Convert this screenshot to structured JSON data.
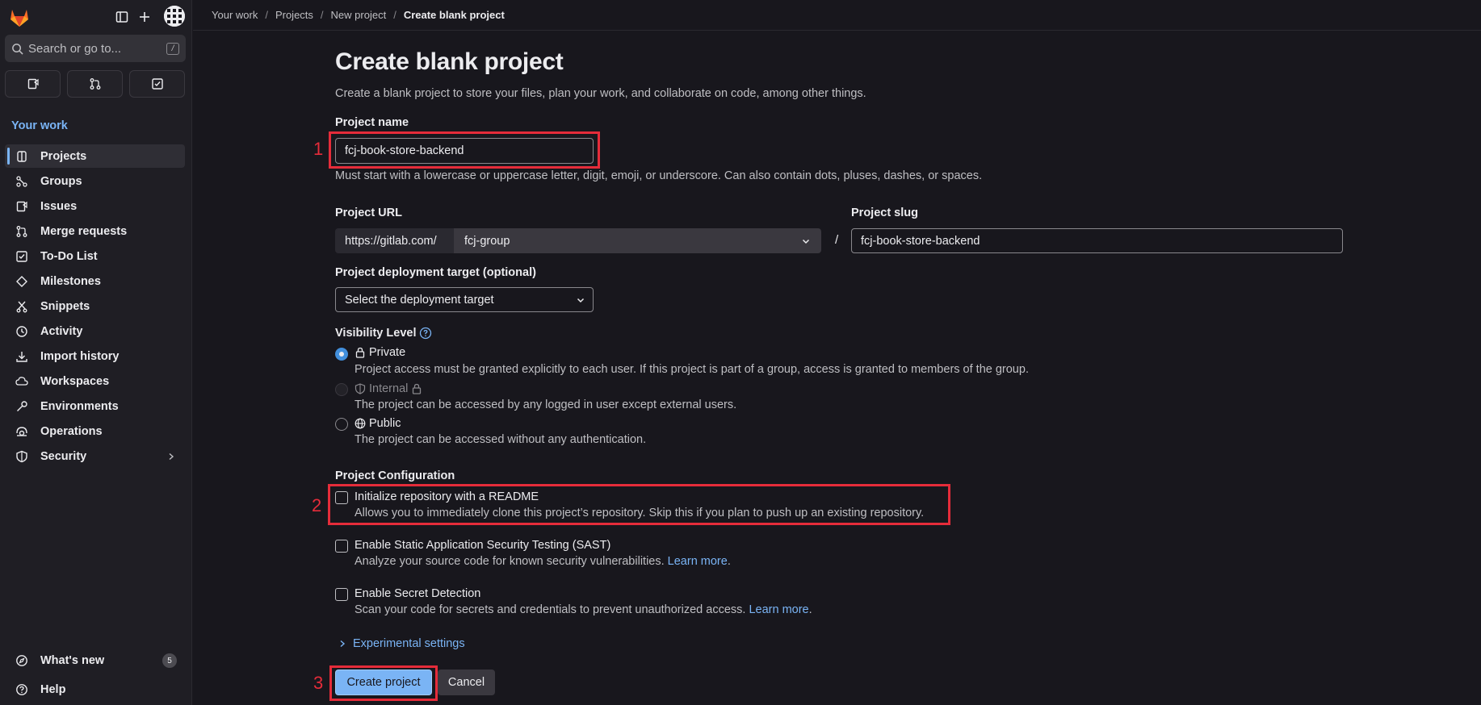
{
  "sidebar": {
    "search_placeholder": "Search or go to...",
    "search_shortcut": "/",
    "section_title": "Your work",
    "items": [
      {
        "label": "Projects",
        "icon": "project-icon",
        "active": true
      },
      {
        "label": "Groups",
        "icon": "group-icon"
      },
      {
        "label": "Issues",
        "icon": "issues-icon"
      },
      {
        "label": "Merge requests",
        "icon": "merge-request-icon"
      },
      {
        "label": "To-Do List",
        "icon": "todo-icon"
      },
      {
        "label": "Milestones",
        "icon": "milestone-icon"
      },
      {
        "label": "Snippets",
        "icon": "snippet-icon"
      },
      {
        "label": "Activity",
        "icon": "activity-icon"
      },
      {
        "label": "Import history",
        "icon": "import-icon"
      },
      {
        "label": "Workspaces",
        "icon": "workspace-icon"
      },
      {
        "label": "Environments",
        "icon": "environment-icon"
      },
      {
        "label": "Operations",
        "icon": "operations-icon"
      },
      {
        "label": "Security",
        "icon": "shield-icon"
      }
    ],
    "whats_new": "What's new",
    "whats_new_count": "5",
    "help": "Help"
  },
  "breadcrumb": [
    "Your work",
    "Projects",
    "New project",
    "Create blank project"
  ],
  "page": {
    "title": "Create blank project",
    "lead": "Create a blank project to store your files, plan your work, and collaborate on code, among other things.",
    "project_name_label": "Project name",
    "project_name_value": "fcj-book-store-backend",
    "project_name_help": "Must start with a lowercase or uppercase letter, digit, emoji, or underscore. Can also contain dots, pluses, dashes, or spaces.",
    "project_url_label": "Project URL",
    "url_prefix": "https://gitlab.com/",
    "namespace": "fcj-group",
    "slash": "/",
    "project_slug_label": "Project slug",
    "project_slug_value": "fcj-book-store-backend",
    "deploy_label": "Project deployment target (optional)",
    "deploy_value": "Select the deployment target",
    "visibility_label": "Visibility Level",
    "visibility": {
      "private": "Private",
      "private_desc": "Project access must be granted explicitly to each user. If this project is part of a group, access is granted to members of the group.",
      "internal": "Internal",
      "internal_desc": "The project can be accessed by any logged in user except external users.",
      "public": "Public",
      "public_desc": "The project can be accessed without any authentication."
    },
    "config_label": "Project Configuration",
    "readme": "Initialize repository with a README",
    "readme_desc": "Allows you to immediately clone this project’s repository. Skip this if you plan to push up an existing repository.",
    "sast": "Enable Static Application Security Testing (SAST)",
    "sast_desc": "Analyze your source code for known security vulnerabilities.",
    "secret": "Enable Secret Detection",
    "secret_desc": "Scan your code for secrets and credentials to prevent unauthorized access.",
    "learn_more": "Learn more",
    "period": ".",
    "experimental": "Experimental settings",
    "create_button": "Create project",
    "cancel_button": "Cancel"
  },
  "annotations": [
    "1",
    "2",
    "3"
  ],
  "colors": {
    "accent": "#7ab4f5",
    "annotation": "#e52c3a",
    "background": "#18171d",
    "sidebar": "#1f1e24"
  }
}
